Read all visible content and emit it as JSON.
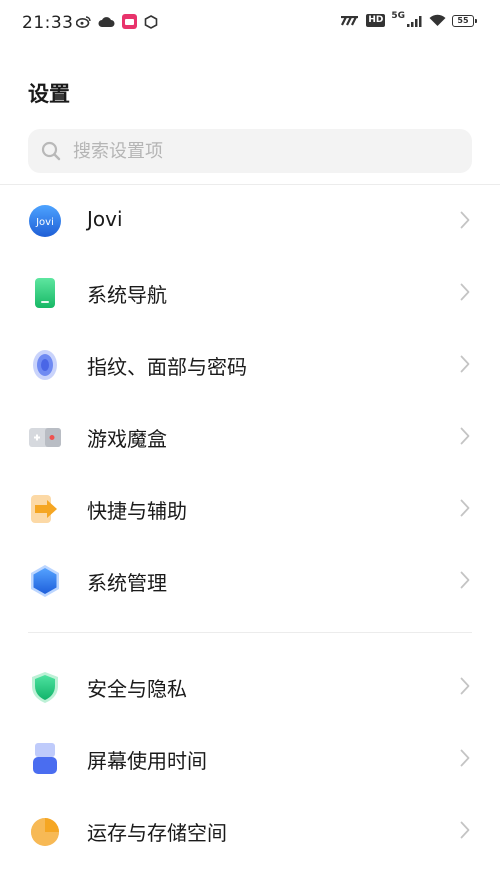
{
  "status_bar": {
    "time": "21:33",
    "left_icons": [
      "weibo-icon",
      "cloud-icon",
      "app-badge-icon",
      "circle-icon"
    ],
    "right_icons": [
      "volte-signal-icon",
      "hd-icon",
      "5g-signal-icon",
      "wifi-icon",
      "battery-icon"
    ],
    "hd_label": "HD",
    "network_label": "5G",
    "battery_level": "55"
  },
  "header": {
    "title": "设置"
  },
  "search": {
    "placeholder": "搜索设置项",
    "value": ""
  },
  "group1": [
    {
      "label": "Jovi",
      "icon": "jovi-icon",
      "color": "#2a7be4"
    },
    {
      "label": "系统导航",
      "icon": "phone-navigation-icon",
      "color": "#27c77a"
    },
    {
      "label": "指纹、面部与密码",
      "icon": "fingerprint-icon",
      "color": "#5b7bf0"
    },
    {
      "label": "游戏魔盒",
      "icon": "game-box-icon",
      "color": "#9aa0a8"
    },
    {
      "label": "快捷与辅助",
      "icon": "shortcut-arrow-icon",
      "color": "#f5a623"
    },
    {
      "label": "系统管理",
      "icon": "hexagon-icon",
      "color": "#2f7af0"
    }
  ],
  "group2": [
    {
      "label": "安全与隐私",
      "icon": "shield-icon",
      "color": "#1fc07a"
    },
    {
      "label": "屏幕使用时间",
      "icon": "hourglass-icon",
      "color": "#4a6df0"
    },
    {
      "label": "运存与存储空间",
      "icon": "pie-chart-icon",
      "color": "#f5a623"
    }
  ],
  "colors": {
    "accent": "#2f7af0",
    "chevron": "#c4c4c4",
    "search_bg": "#f3f3f3"
  }
}
